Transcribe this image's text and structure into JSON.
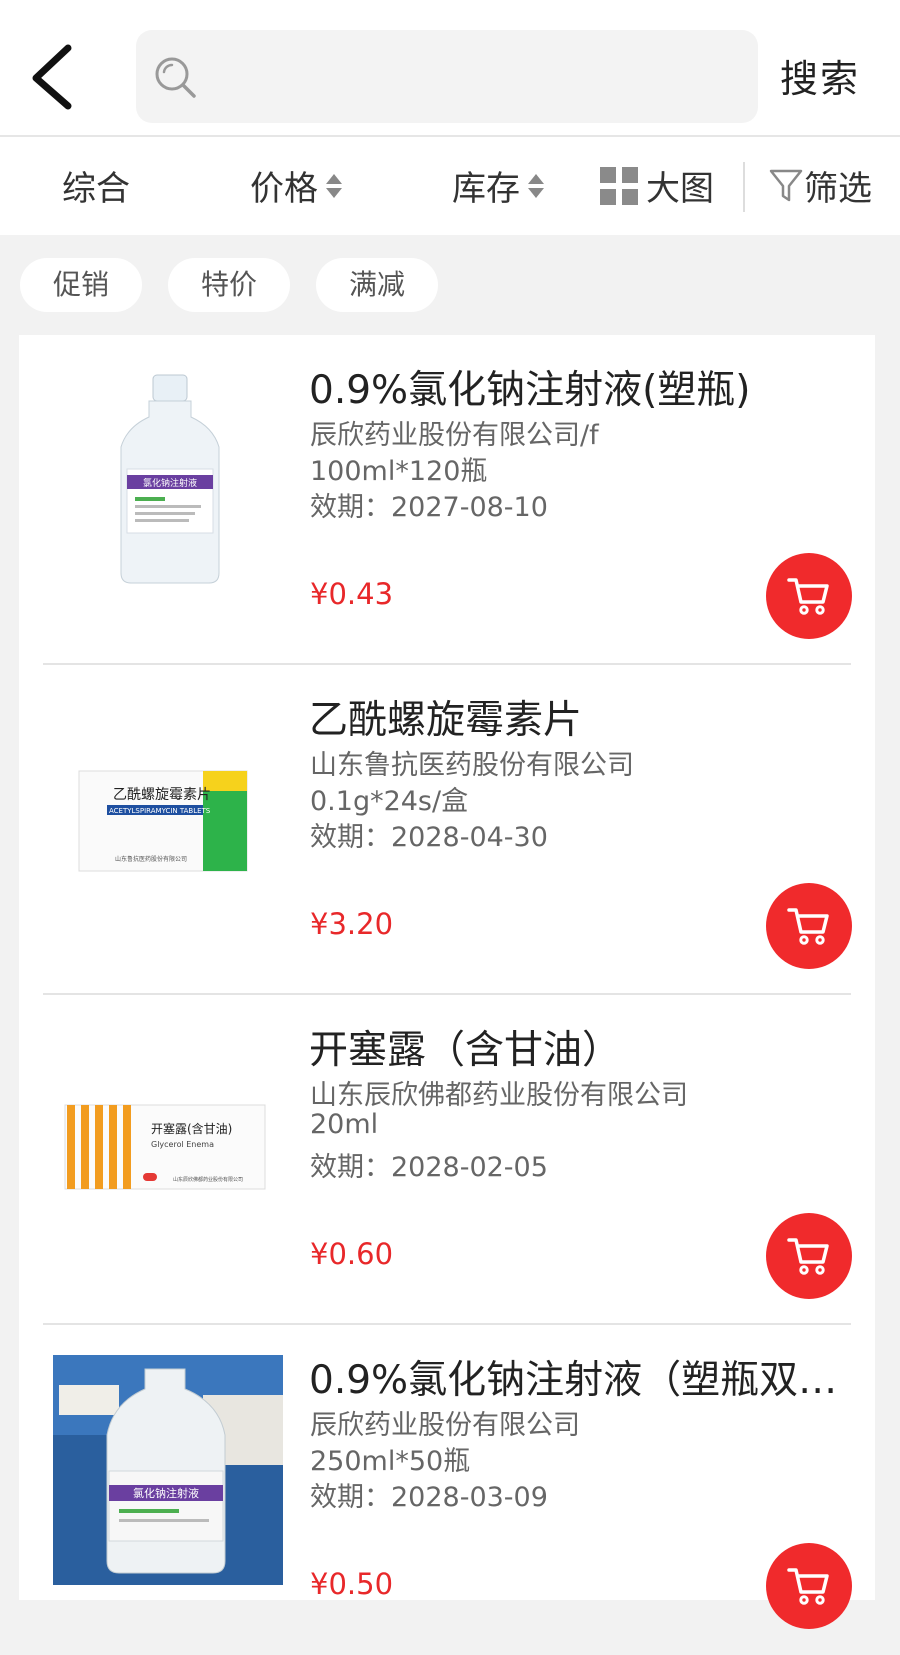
{
  "header": {
    "search_placeholder": "",
    "search_value": "",
    "search_button": "搜索"
  },
  "sortbar": {
    "general": "综合",
    "price": "价格",
    "stock": "库存",
    "big_image": "大图",
    "filter": "筛选"
  },
  "tags": [
    "促销",
    "特价",
    "满减"
  ],
  "products": [
    {
      "name": "0.9%氯化钠注射液(塑瓶)",
      "maker": "辰欣药业股份有限公司/f",
      "spec": "100ml*120瓶",
      "expiry": "效期：2027-08-10",
      "price": "¥0.43"
    },
    {
      "name": "乙酰螺旋霉素片",
      "maker": "山东鲁抗医药股份有限公司",
      "spec": "0.1g*24s/盒",
      "expiry": "效期：2028-04-30",
      "price": "¥3.20"
    },
    {
      "name": "开塞露（含甘油）",
      "maker": "山东辰欣佛都药业股份有限公司",
      "spec": "20ml",
      "expiry": "效期：2028-02-05",
      "price": "¥0.60"
    },
    {
      "name": "0.9%氯化钠注射液（塑瓶双口…",
      "maker": "辰欣药业股份有限公司",
      "spec": "250ml*50瓶",
      "expiry": "效期：2028-03-09",
      "price": "¥0.50"
    }
  ],
  "thumb_text": {
    "p1_label": "氯化钠注射液",
    "p2_label": "乙酰螺旋霉素片",
    "p2_sub": "ACETYLSPIRAMYCIN TABLETS",
    "p2_maker": "山东鲁抗医药股份有限公司",
    "p3_label": "开塞露(含甘油)",
    "p3_sub": "Glycerol Enema",
    "p3_maker": "山东辰欣佛都药业股份有限公司",
    "p4_label": "氯化钠注射液"
  },
  "colors": {
    "accent": "#f02a2c",
    "price": "#e8282a",
    "background": "#f2f2f2"
  }
}
